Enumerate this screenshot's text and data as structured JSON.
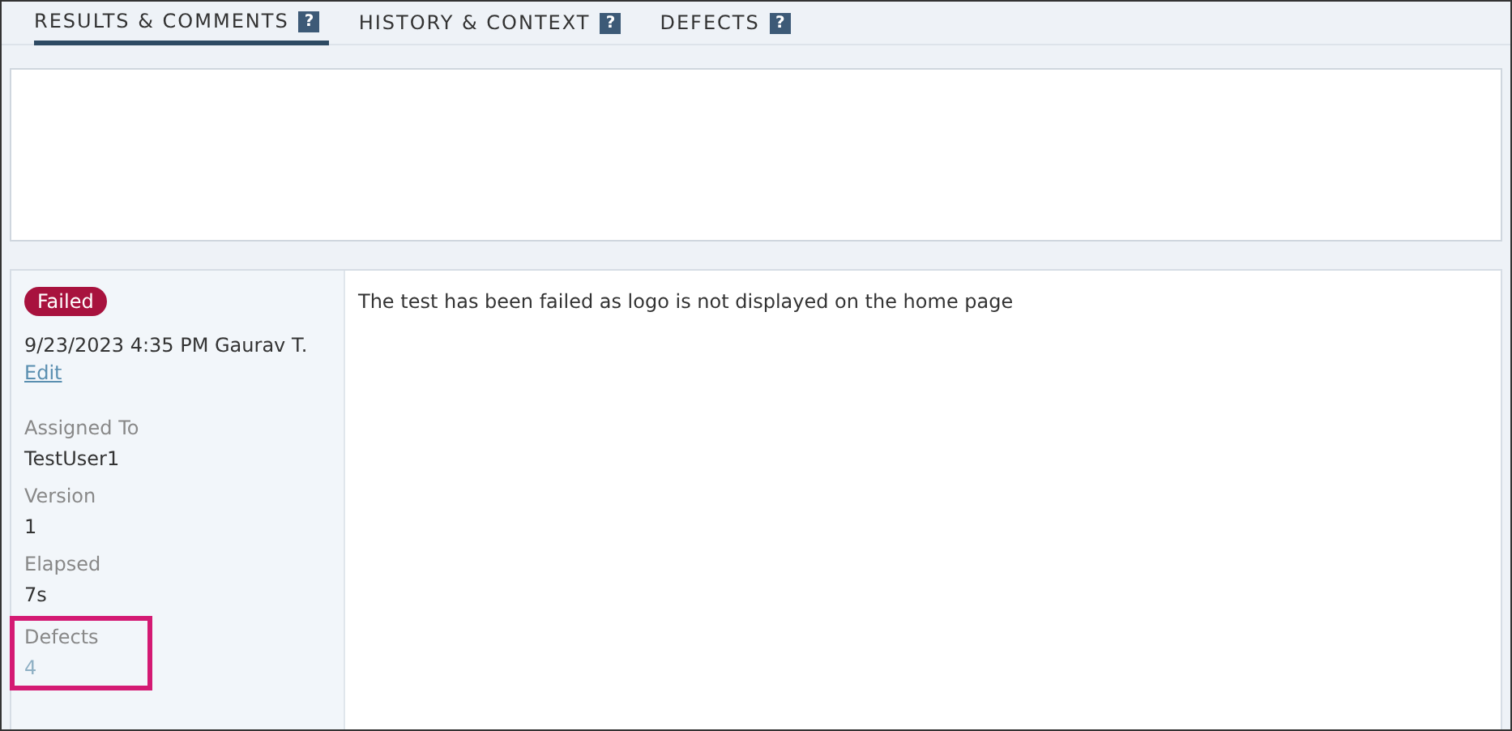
{
  "tabs": [
    {
      "label": "RESULTS & COMMENTS",
      "help": "?",
      "selected": true
    },
    {
      "label": "HISTORY & CONTEXT",
      "help": "?",
      "selected": false
    },
    {
      "label": "DEFECTS",
      "help": "?",
      "selected": false
    }
  ],
  "result": {
    "status": "Failed",
    "color": "#a8123e",
    "timestamp": "9/23/2023 4:35 PM Gaurav T.",
    "edit_link": "Edit",
    "fields": [
      {
        "label": "Assigned To",
        "value": "TestUser1",
        "kind": "text",
        "highlighted": false
      },
      {
        "label": "Version",
        "value": "1",
        "kind": "text",
        "highlighted": false
      },
      {
        "label": "Elapsed",
        "value": "7s",
        "kind": "text",
        "highlighted": false
      },
      {
        "label": "Defects",
        "value": "4",
        "kind": "link",
        "highlighted": true
      }
    ],
    "comment": "The test has been failed as logo is not displayed on the home page"
  }
}
